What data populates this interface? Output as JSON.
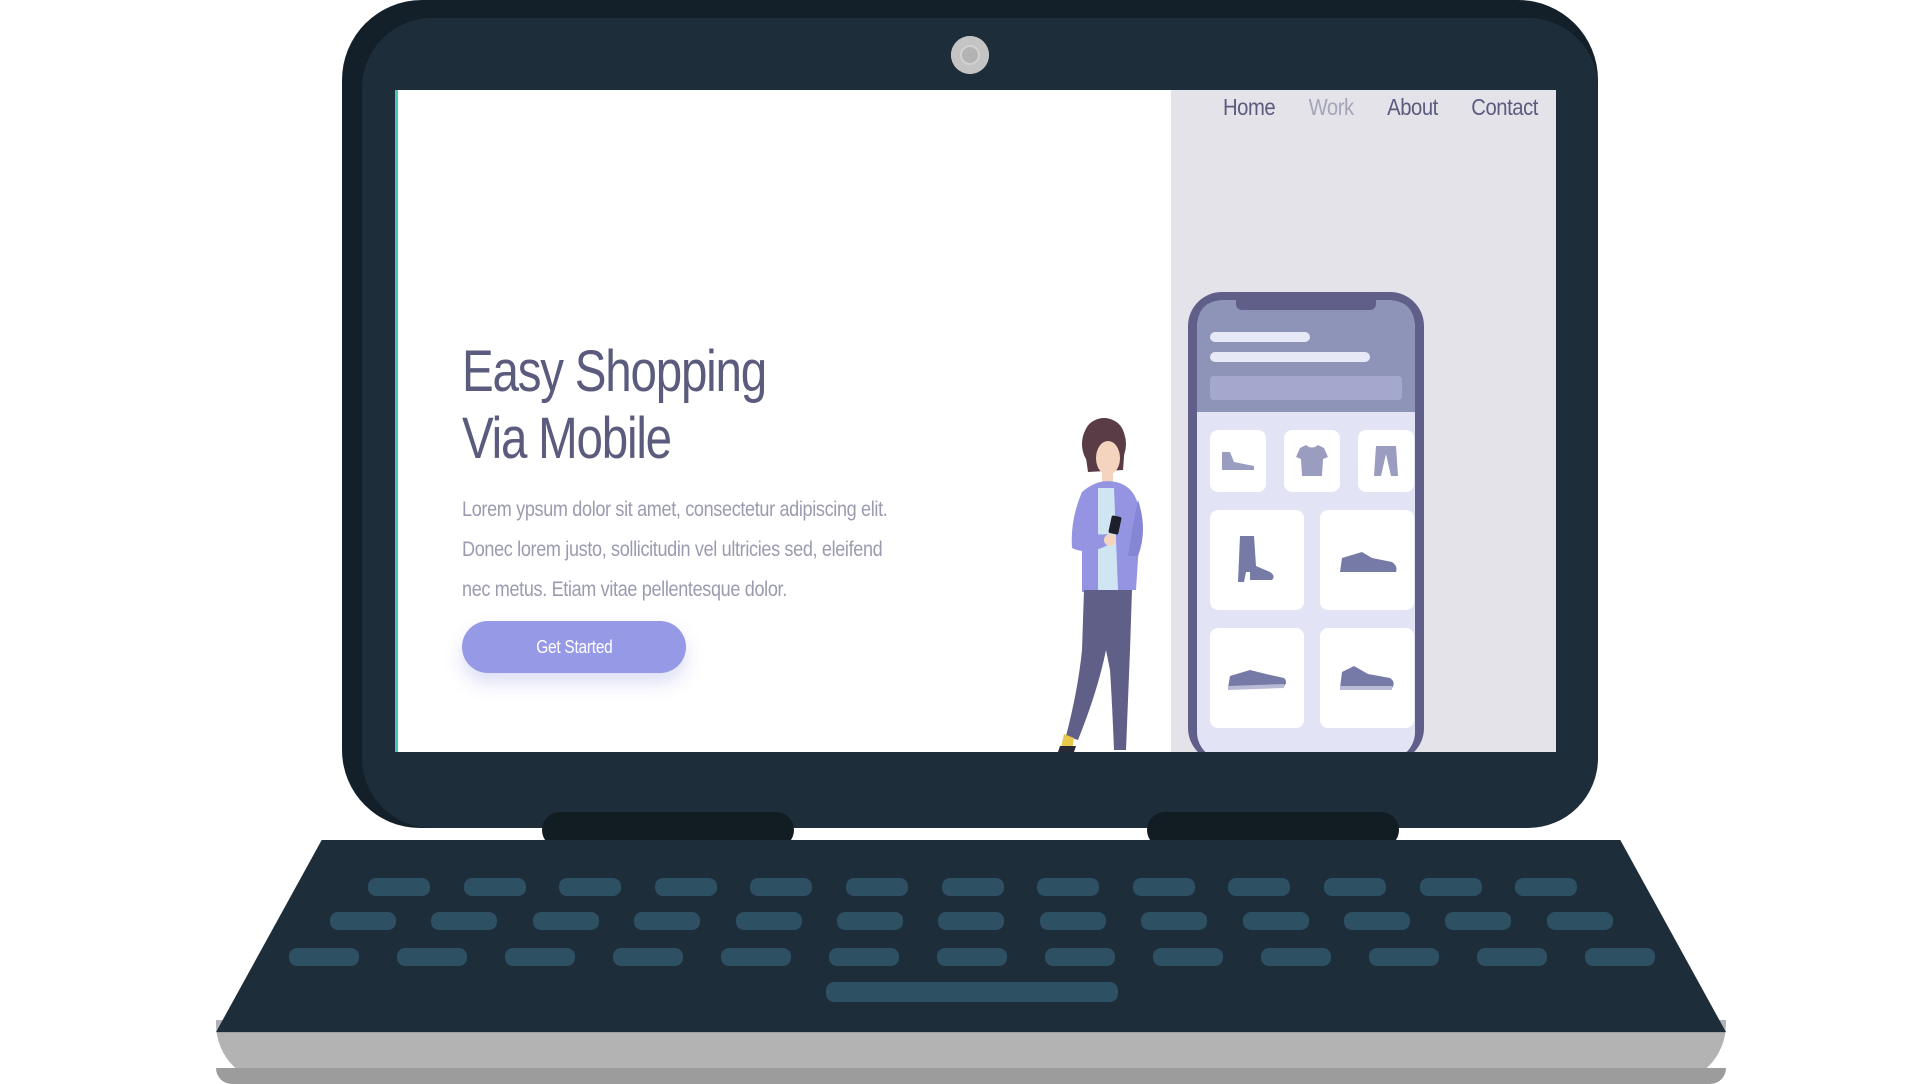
{
  "colors": {
    "laptop_frame": "#1e2d3a",
    "laptop_frame_dark": "#13202a",
    "key": "#2d5063",
    "screen_panel": "#e4e3ea",
    "heading": "#5b5b7e",
    "body_text": "#9b9bb0",
    "nav_active": "#a5a5ba",
    "accent": "#9699e6",
    "phone_frame": "#5f5f8a"
  },
  "nav": {
    "items": [
      {
        "label": "Home",
        "active": false
      },
      {
        "label": "Work",
        "active": true
      },
      {
        "label": "About",
        "active": false
      },
      {
        "label": "Contact",
        "active": false
      }
    ]
  },
  "hero": {
    "title_line1": "Easy Shopping",
    "title_line2": "Via Mobile",
    "body": "Lorem ypsum dolor sit amet, consectetur adipiscing elit. Donec lorem justo, sollicitudin vel ultricies sed, eleifend nec metus. Etiam vitae pellentesque dolor.",
    "cta_label": "Get Started"
  },
  "illustration": {
    "phone_categories": [
      "shoe-icon",
      "tshirt-icon",
      "pants-icon"
    ],
    "phone_products": [
      "boot-icon",
      "sneaker-icon",
      "sneaker-icon",
      "sneaker-icon"
    ],
    "person": "woman-with-phone"
  }
}
